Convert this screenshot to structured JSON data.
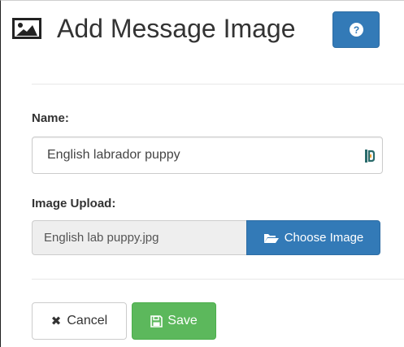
{
  "header": {
    "title": "Add Message Image",
    "icon": "image-icon",
    "help_icon": "question-circle-icon",
    "help_button_color": "#337ab7"
  },
  "form": {
    "name_label": "Name:",
    "name_value": "English labrador puppy",
    "name_addon_icon": "field-autofill-icon",
    "upload_label": "Image Upload:",
    "upload_file_name": "English lab puppy.jpg",
    "choose_image_label": "Choose Image",
    "choose_image_icon": "folder-open-icon"
  },
  "actions": {
    "cancel_label": "Cancel",
    "cancel_icon": "close-icon",
    "save_label": "Save",
    "save_icon": "floppy-disk-icon",
    "save_color": "#5cb85c"
  }
}
